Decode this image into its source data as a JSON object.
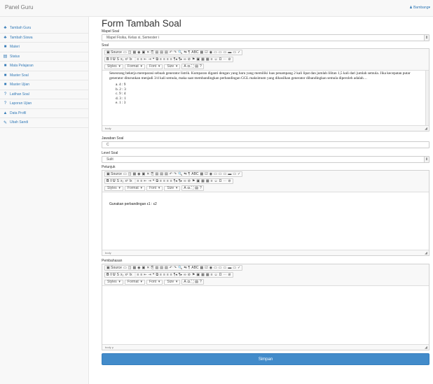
{
  "app": {
    "brand": "Panel Guru",
    "user": "♟ Bambang▾"
  },
  "sidebar": {
    "items": [
      {
        "icon": "♣",
        "label": "Tambah Guru",
        "icon_name": "users-icon"
      },
      {
        "icon": "♣",
        "label": "Tambah Siswa",
        "icon_name": "users-icon"
      },
      {
        "icon": "■",
        "label": "Materi",
        "icon_name": "book-icon"
      },
      {
        "icon": "▤",
        "label": "Status",
        "icon_name": "list-icon"
      },
      {
        "icon": "■",
        "label": "Mata Pelajaran",
        "icon_name": "book-icon"
      },
      {
        "icon": "■",
        "label": "Master Soal",
        "icon_name": "book-icon"
      },
      {
        "icon": "■",
        "label": "Master Ujian",
        "icon_name": "book-icon"
      },
      {
        "icon": "?",
        "label": "Latihan Soal",
        "icon_name": "question-icon"
      },
      {
        "icon": "?",
        "label": "Laporan Ujian",
        "icon_name": "question-icon"
      },
      {
        "icon": "▲",
        "label": "Data Profil",
        "icon_name": "user-icon"
      },
      {
        "icon": "✎",
        "label": "Ubah Sandi",
        "icon_name": "edit-icon"
      }
    ]
  },
  "form": {
    "title": "Form Tambah Soal",
    "mapel": {
      "label": "Mapel Soal",
      "value": "Mapel Fisika, Kelas xi, Semester i"
    },
    "soal": {
      "label": "Soal",
      "text": "Seseorang bekerja mereparasi sebuah generator listrik. Kumparan diganti dengan yang baru yang memiliki luas penampang 2 kali lipat dan jumlah lilitan 1,5 kali dari jumlah semula. Jika kecepatan putar generator diturunkan menjadi 3/4 kali semula, maka saat membandingkan perbandingan GGL maksimum yang dihasilkan generator dibandingkan semula diperoleh adalah…",
      "options": [
        "a. 4 : 9",
        "b. 2 : 3",
        "c. 9 : 4",
        "d. 3 : 1",
        "e. 1 : 3"
      ],
      "status": "body"
    },
    "jawaban": {
      "label": "Jawaban Soal",
      "value": "C"
    },
    "level": {
      "label": "Level Soal",
      "value": "Sulit"
    },
    "petunjuk": {
      "label": "Petunjuk",
      "text": "Gunakan perbandingan ε1 : ε2",
      "status": "body"
    },
    "pembahasan": {
      "label": "Pembahasan",
      "text": "",
      "status": "body  p"
    },
    "submit": "Simpan"
  },
  "toolbar": {
    "row1": [
      "▣ Source",
      "▭",
      "◫",
      "▦",
      "◉",
      "▣",
      "✕",
      "⎘",
      "▤",
      "▤",
      "▤",
      "↶",
      "↷",
      "🔍",
      "⇆",
      "¶",
      "ABC",
      "▦",
      "☑",
      "◉",
      "▭",
      "▭",
      "▭",
      "▬",
      "▭",
      "✓"
    ],
    "row2": [
      "B",
      "I",
      "U",
      "S",
      "x₂",
      "x²",
      "Ix",
      "⋮≡",
      "≡",
      "⇤",
      "⇥",
      "❝",
      "⧉",
      "≡",
      "≡",
      "≡",
      "≡",
      "¶◂",
      "¶▸",
      "∞",
      "⊘",
      "⚑",
      "▣",
      "▦",
      "▦",
      "≡",
      "☺",
      "Ω",
      "⋯",
      "⊘"
    ],
    "styles": "Styles",
    "format": "Format",
    "font": "Font",
    "size": "Size",
    "a": "A",
    "b": "◘",
    "maximize": "⛶",
    "blocks": "▤",
    "help": "?"
  }
}
